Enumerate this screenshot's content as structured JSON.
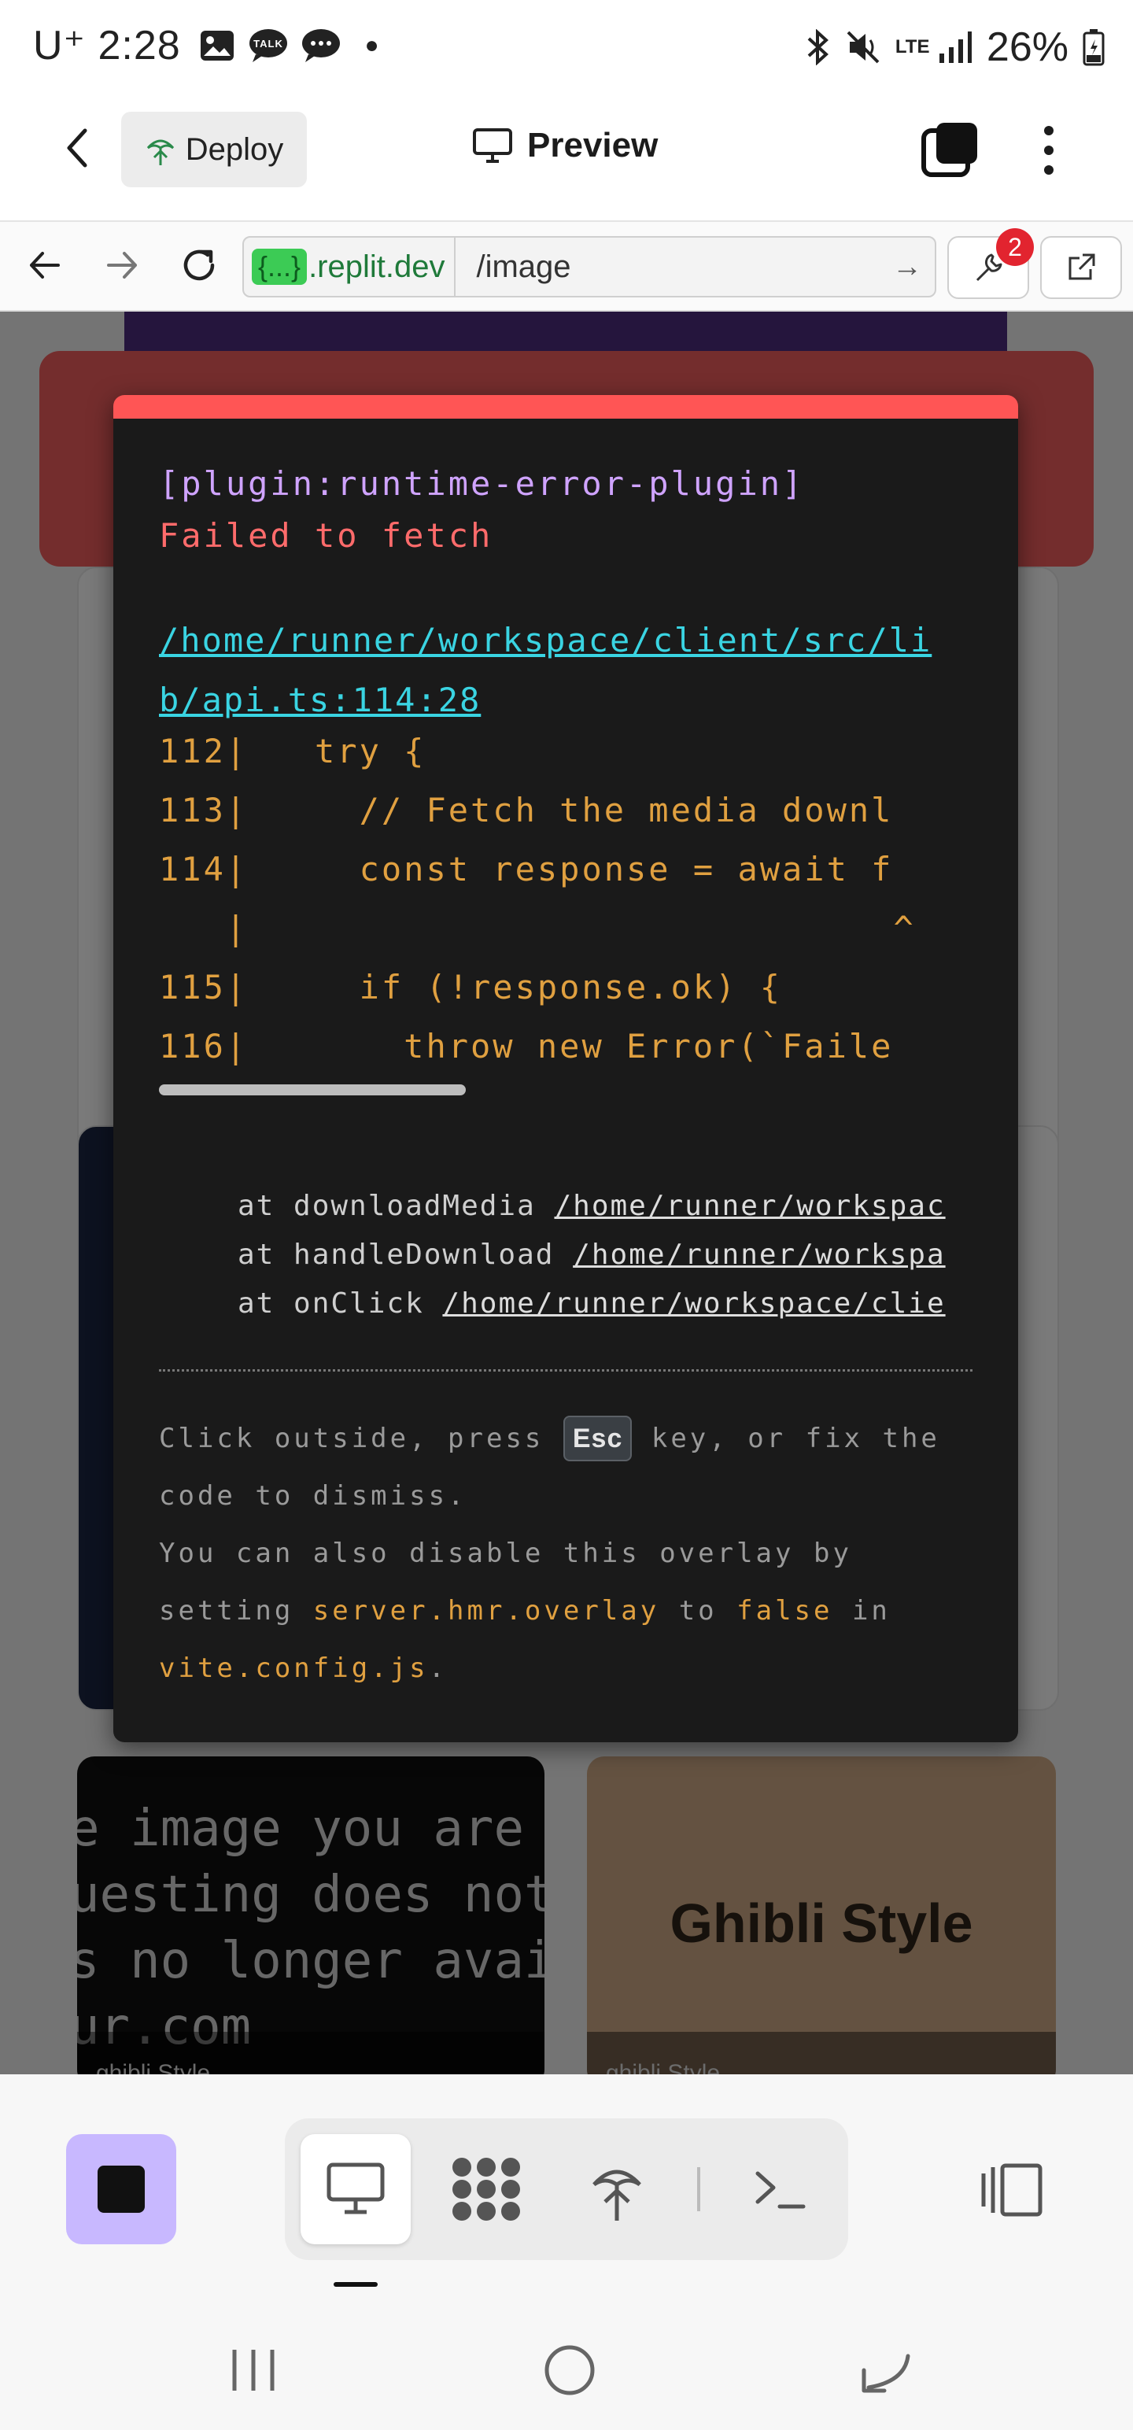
{
  "status_bar": {
    "carrier": "U⁺",
    "time": "2:28",
    "battery": "26%",
    "network": "LTE"
  },
  "top_bar": {
    "deploy_label": "Deploy",
    "preview_label": "Preview"
  },
  "address_bar": {
    "host_badge": "{...}",
    "host": ".replit.dev",
    "path": "/image",
    "error_count": "2"
  },
  "background_page": {
    "tile_dark_text": [
      "e image you are",
      "uesting does not e",
      "s no longer availab",
      "ur.com"
    ],
    "tile_tan_title": "Ghibli Style",
    "tile_caption_left": "ghibli Style",
    "tile_caption_right": "ghibli Style"
  },
  "overlay": {
    "plugin": "[plugin:runtime-error-plugin]",
    "message": "Failed to fetch",
    "file_link": "/home/runner/workspace/client/src/lib/api.ts:114:28",
    "code_frame": [
      {
        "num": "112",
        "code": "   try {"
      },
      {
        "num": "113",
        "code": "     // Fetch the media downl"
      },
      {
        "num": "114",
        "code": "     const response = await f"
      },
      {
        "num": "   ",
        "code": "                             ^"
      },
      {
        "num": "115",
        "code": "     if (!response.ok) {"
      },
      {
        "num": "116",
        "code": "       throw new Error(`Faile"
      }
    ],
    "stack": [
      {
        "fn": "at downloadMedia ",
        "path": "/home/runner/workspac"
      },
      {
        "fn": "at handleDownload ",
        "path": "/home/runner/workspa"
      },
      {
        "fn": "at onClick ",
        "path": "/home/runner/workspace/clie"
      }
    ],
    "tip": {
      "part1": "Click outside, press ",
      "key": "Esc",
      "part2": " key, or fix the code to dismiss.",
      "line2a": "You can also disable this overlay by setting ",
      "setting": "server.hmr.overlay",
      "line2b": " to ",
      "value": "false",
      "line2c": " in ",
      "file": "vite.config.js",
      "line2d": "."
    }
  },
  "colors": {
    "accent_red": "#ff5555",
    "stop_button": "#c8b8ff",
    "code_orange": "#e0a040",
    "link_cyan": "#3ad4e2",
    "plugin_purple": "#cfa3ff"
  },
  "icons": [
    "back-arrow-icon",
    "deploy-icon",
    "monitor-icon",
    "layers-icon",
    "more-vertical-icon",
    "browser-back-icon",
    "browser-forward-icon",
    "reload-icon",
    "go-arrow-icon",
    "devtools-wrench-icon",
    "open-external-icon",
    "stop-icon",
    "desktop-tool-icon",
    "apps-tool-icon",
    "deploy-tool-icon",
    "terminal-icon",
    "split-view-icon",
    "recent-apps-icon",
    "home-icon",
    "nav-back-icon"
  ]
}
